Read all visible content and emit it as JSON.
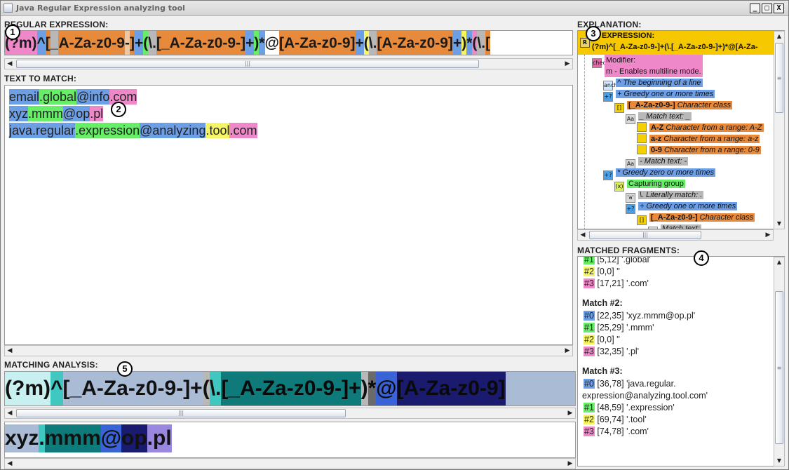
{
  "window": {
    "title": "Java Regular Expression analyzing tool",
    "buttons": [
      "_",
      "□",
      "X"
    ]
  },
  "labels": {
    "regex": "REGULAR EXPRESSION:",
    "text": "TEXT TO MATCH:",
    "analysis": "MATCHING ANALYSIS:",
    "explanation": "EXPLANATION:",
    "matched": "MATCHED FRAGMENTS:"
  },
  "callouts": [
    "1",
    "2",
    "3",
    "4",
    "5"
  ],
  "colors": {
    "pink": "#ee88c8",
    "blue": "#6d9fe6",
    "green": "#66ee66",
    "orange": "#e88a3c",
    "gray": "#b8b8b8",
    "yellow": "#f5f566",
    "teal": "#40c8c0",
    "darkteal": "#0f7a7a",
    "navy": "#1a1a6e",
    "lightblue": "#aabbd6",
    "cyan": "#c8f0f0",
    "purple": "#9a88e0"
  },
  "regex_tokens": [
    {
      "text": "(?m)",
      "color": "#ee88c8"
    },
    {
      "text": "^",
      "color": "#6d9fe6"
    },
    {
      "text": "[",
      "color": "#e88a3c"
    },
    {
      "text": "_",
      "color": "#b8b8b8"
    },
    {
      "text": "A-Za-z0-9",
      "color": "#e88a3c"
    },
    {
      "text": "-",
      "color": "#f0c8a0"
    },
    {
      "text": "]",
      "color": "#e88a3c"
    },
    {
      "text": "+",
      "color": "#6d9fe6"
    },
    {
      "text": "(",
      "color": "#66ee66"
    },
    {
      "text": "\\.",
      "color": "#b8b8b8"
    },
    {
      "text": "[_A-Za-z0-9-]",
      "color": "#e88a3c"
    },
    {
      "text": "+",
      "color": "#6d9fe6"
    },
    {
      "text": ")",
      "color": "#66ee66"
    },
    {
      "text": "*",
      "color": "#6d9fe6"
    },
    {
      "text": "@",
      "color": "#ffffff"
    },
    {
      "text": "[A-Za-z0-9]",
      "color": "#e88a3c"
    },
    {
      "text": "+",
      "color": "#6d9fe6"
    },
    {
      "text": "(",
      "color": "#f5f566"
    },
    {
      "text": "\\.",
      "color": "#b8b8b8"
    },
    {
      "text": "[A-Za-z0-9]",
      "color": "#e88a3c"
    },
    {
      "text": "+",
      "color": "#6d9fe6"
    },
    {
      "text": ")",
      "color": "#f5f566"
    },
    {
      "text": "*",
      "color": "#6d9fe6"
    },
    {
      "text": "(",
      "color": "#ee88c8"
    },
    {
      "text": "\\.",
      "color": "#b8b8b8"
    },
    {
      "text": "[",
      "color": "#e88a3c"
    }
  ],
  "text_lines": [
    [
      {
        "text": "email",
        "color": "#6d9fe6"
      },
      {
        "text": ".global",
        "color": "#66ee66"
      },
      {
        "text": "@info",
        "color": "#6d9fe6"
      },
      {
        "text": ".com",
        "color": "#ee88c8"
      }
    ],
    [
      {
        "text": "xyz",
        "color": "#6d9fe6"
      },
      {
        "text": ".mmm",
        "color": "#66ee66"
      },
      {
        "text": "@op",
        "color": "#6d9fe6"
      },
      {
        "text": ".pl",
        "color": "#ee88c8"
      }
    ],
    [
      {
        "text": "java",
        "color": "#6d9fe6"
      },
      {
        "text": ".regular",
        "color": "#6d9fe6"
      },
      {
        "text": ".expression",
        "color": "#66ee66"
      },
      {
        "text": "@analyzing",
        "color": "#6d9fe6"
      },
      {
        "text": ".tool",
        "color": "#f5f566"
      },
      {
        "text": ".com",
        "color": "#ee88c8"
      }
    ]
  ],
  "analysis_regex": [
    {
      "text": "(?m)",
      "color": "#c8f0f0"
    },
    {
      "text": "^",
      "color": "#40c8c0"
    },
    {
      "text": "[_A-Za-z0-9-]+",
      "color": "#aabbd6"
    },
    {
      "text": "(",
      "color": "#b8b8b8"
    },
    {
      "text": "\\.",
      "color": "#40c8c0"
    },
    {
      "text": "[_A-Za-z0-9-]+",
      "color": "#0f7a7a"
    },
    {
      "text": ")",
      "color": "#b8b8b8"
    },
    {
      "text": "*",
      "color": "#6a6a6a"
    },
    {
      "text": "@",
      "color": "#3a63d8"
    },
    {
      "text": "[A-Za-z0-9]",
      "color": "#1a1a6e"
    }
  ],
  "analysis_text": [
    {
      "text": "xyz",
      "color": "#aabbd6"
    },
    {
      "text": ".",
      "color": "#40c8c0"
    },
    {
      "text": "mmm",
      "color": "#0f7a7a"
    },
    {
      "text": "@",
      "color": "#3a63d8"
    },
    {
      "text": "op",
      "color": "#1a1a6e"
    },
    {
      "text": ".pl",
      "color": "#9a88e0"
    }
  ],
  "explanation_tree": {
    "root_label": "EXPRESSION:",
    "root_value": "(?m)^[_A-Za-z0-9-]+(\\.[_A-Za-z0-9-]+)*@[A-Za-",
    "nodes": [
      {
        "label": "Modifier:",
        "sub": "m - Enables multiline mode.",
        "icon": "check-icon",
        "color": "#ee88c8"
      },
      {
        "label": "^ The beginning of a line",
        "icon": "anchor-icon",
        "color": "#6d9fe6"
      },
      {
        "label": "+ Greedy one or more times",
        "icon": "+?",
        "color": "#6d9fe6"
      },
      {
        "label": "[_A-Za-z0-9-]",
        "sub": " Character class",
        "icon": "[]",
        "color": "#e88a3c"
      },
      {
        "label": "_ Match text: _",
        "icon": "Aa",
        "color": "#b8b8b8"
      },
      {
        "label": "A-Z",
        "sub": " Character from a range: A-Z",
        "icon": "",
        "color": "#e88a3c"
      },
      {
        "label": "a-z",
        "sub": " Character from a range: a-z",
        "icon": "",
        "color": "#e88a3c"
      },
      {
        "label": "0-9",
        "sub": " Character from a range: 0-9",
        "icon": "",
        "color": "#e88a3c"
      },
      {
        "label": "- Match text: -",
        "icon": "Aa",
        "color": "#b8b8b8"
      },
      {
        "label": "* Greedy zero or more times",
        "icon": "+?",
        "color": "#6d9fe6"
      },
      {
        "label": "Capturing group",
        "icon": "(x)",
        "color": "#66ee66"
      },
      {
        "label": "\\. Literally match: .",
        "icon": "'a'",
        "color": "#b8b8b8"
      },
      {
        "label": "+ Greedy one or more times",
        "icon": "+?",
        "color": "#6d9fe6"
      },
      {
        "label": "[_A-Za-z0-9-]",
        "sub": " Character class",
        "icon": "[]",
        "color": "#e88a3c"
      },
      {
        "label": "Match text:",
        "icon": "Aa",
        "color": "#b8b8b8"
      }
    ]
  },
  "matched_fragments": [
    {
      "type": "line",
      "tag": "#1",
      "tagcolor": "#66ee66",
      "text": " [5,12] '.global'"
    },
    {
      "type": "line",
      "tag": "#2",
      "tagcolor": "#f5f566",
      "text": " [0,0] ''"
    },
    {
      "type": "line",
      "tag": "#3",
      "tagcolor": "#ee88c8",
      "text": " [17,21] '.com'"
    },
    {
      "type": "head",
      "text": "Match #2:"
    },
    {
      "type": "line",
      "tag": "#0",
      "tagcolor": "#6d9fe6",
      "text": " [22,35] 'xyz.mmm@op.pl'"
    },
    {
      "type": "line",
      "tag": "#1",
      "tagcolor": "#66ee66",
      "text": " [25,29] '.mmm'"
    },
    {
      "type": "line",
      "tag": "#2",
      "tagcolor": "#f5f566",
      "text": " [0,0] ''"
    },
    {
      "type": "line",
      "tag": "#3",
      "tagcolor": "#ee88c8",
      "text": " [32,35] '.pl'"
    },
    {
      "type": "head",
      "text": "Match #3:"
    },
    {
      "type": "line",
      "tag": "#0",
      "tagcolor": "#6d9fe6",
      "text": " [36,78] 'java.regular."
    },
    {
      "type": "cont",
      "text": "expression@analyzing.tool.com'"
    },
    {
      "type": "line",
      "tag": "#1",
      "tagcolor": "#66ee66",
      "text": " [48,59] '.expression'"
    },
    {
      "type": "line",
      "tag": "#2",
      "tagcolor": "#f5f566",
      "text": " [69,74] '.tool'"
    },
    {
      "type": "line",
      "tag": "#3",
      "tagcolor": "#ee88c8",
      "text": " [74,78] '.com'"
    }
  ],
  "scroll_glyphs": {
    "left": "◀",
    "right": "▶",
    "up": "▲",
    "down": "▼",
    "grip": "|||",
    "grip_v": "≡"
  }
}
